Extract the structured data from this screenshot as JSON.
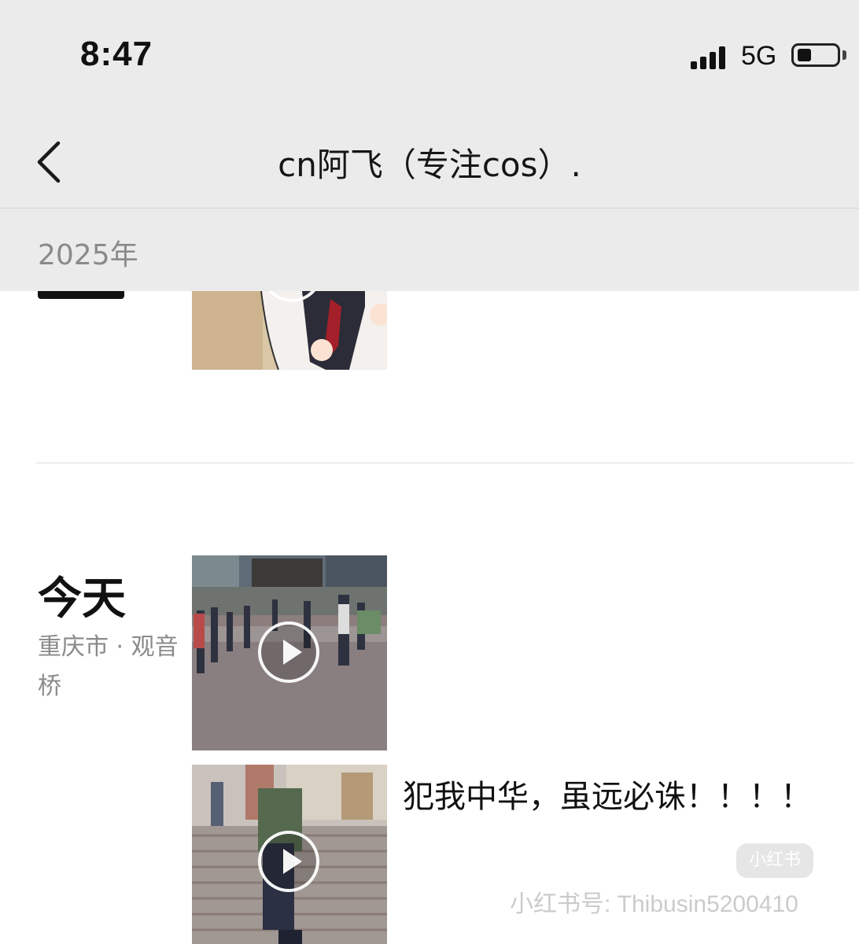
{
  "status_bar": {
    "time": "8:47",
    "network": "5G",
    "battery_level": 0.38
  },
  "nav": {
    "title": "cn阿飞（专注cos）."
  },
  "year_header": {
    "label": "2025年"
  },
  "today": {
    "day_label": "今天",
    "location": "重庆市 · 观音桥",
    "caption": "犯我中华，虽远必诛！！！！"
  },
  "watermark": {
    "logo": "小红书",
    "id": "小红书号: Thibusin5200410"
  },
  "icons": [
    "back-chevron-icon",
    "cellular-signal-icon",
    "battery-icon",
    "play-icon"
  ]
}
